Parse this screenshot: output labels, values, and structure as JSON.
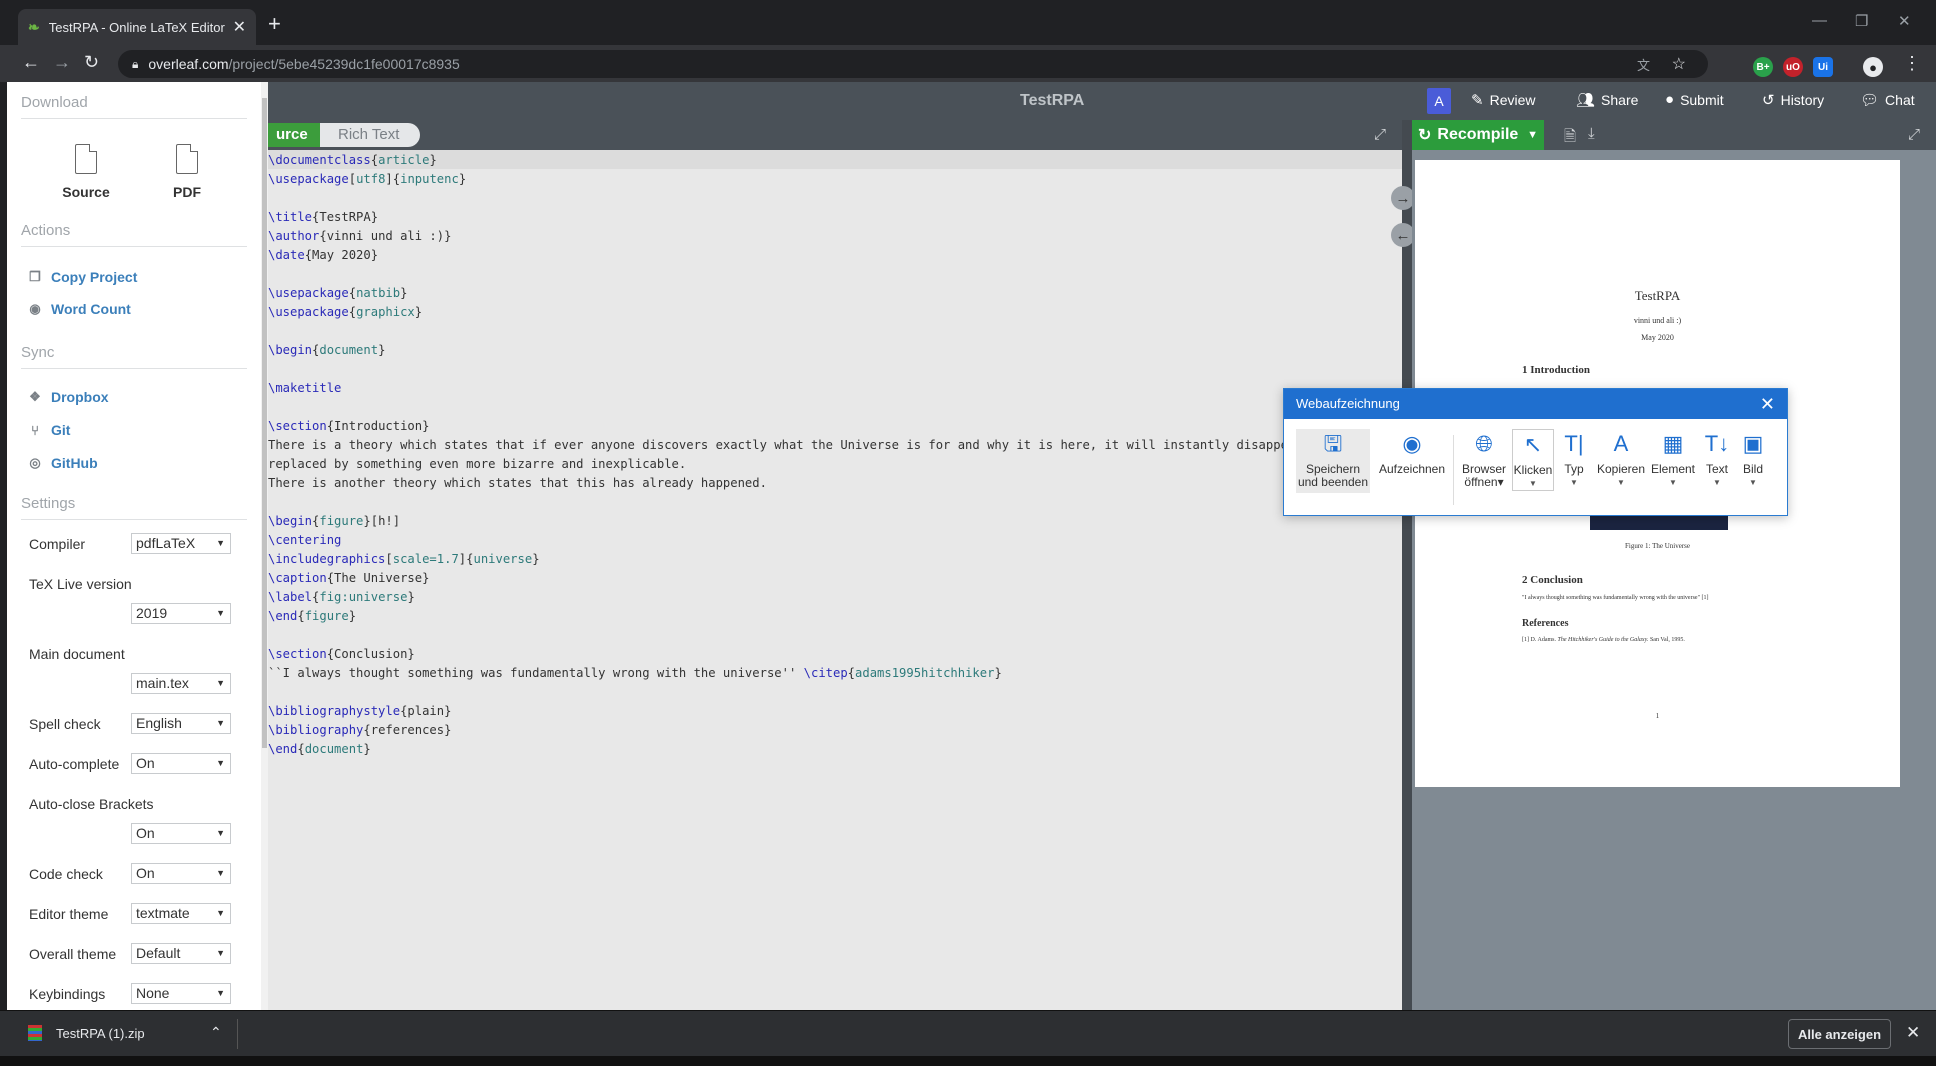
{
  "browser": {
    "tab_title": "TestRPA - Online LaTeX Editor Ov",
    "tab_favicon": "overleaf-leaf-icon",
    "new_tab": "+",
    "url_domain": "overleaf.com",
    "url_path": "/project/5ebe45239dc1fe00017c8935",
    "extensions": [
      "B+",
      "uO",
      "Ui"
    ]
  },
  "toolbar": {
    "project_title": "TestRPA",
    "avatar_letter": "A",
    "review": "Review",
    "share": "Share",
    "submit": "Submit",
    "history": "History",
    "chat": "Chat"
  },
  "sidebar": {
    "download_header": "Download",
    "download_source": "Source",
    "download_pdf": "PDF",
    "actions_header": "Actions",
    "copy_project": "Copy Project",
    "word_count": "Word Count",
    "sync_header": "Sync",
    "dropbox": "Dropbox",
    "git": "Git",
    "github": "GitHub",
    "settings_header": "Settings",
    "settings": {
      "compiler": {
        "label": "Compiler",
        "value": "pdfLaTeX"
      },
      "texlive": {
        "label": "TeX Live version",
        "value": "2019"
      },
      "main_document": {
        "label": "Main document",
        "value": "main.tex"
      },
      "spell_check": {
        "label": "Spell check",
        "value": "English"
      },
      "auto_complete": {
        "label": "Auto-complete",
        "value": "On"
      },
      "auto_close": {
        "label": "Auto-close Brackets",
        "value": "On"
      },
      "code_check": {
        "label": "Code check",
        "value": "On"
      },
      "editor_theme": {
        "label": "Editor theme",
        "value": "textmate"
      },
      "overall_theme": {
        "label": "Overall theme",
        "value": "Default"
      },
      "keybindings": {
        "label": "Keybindings",
        "value": "None"
      }
    }
  },
  "editor": {
    "source_tab": "urce",
    "rich_text_tab": "Rich Text"
  },
  "pdf": {
    "recompile": "Recompile",
    "title": "TestRPA",
    "author": "vinni und ali :)",
    "date": "May 2020",
    "sec1": "1   Introduction",
    "fig_caption": "Figure 1: The Universe",
    "sec2": "2   Conclusion",
    "conclusion_text": "\"I always thought something was fundamentally wrong with the universe\" [1]",
    "references": "References",
    "ref1_a": "[1] D. Adams.",
    "ref1_b": "The Hitchhiker's Guide to the Galaxy.",
    "ref1_c": "San Val, 1995.",
    "page_number": "1"
  },
  "popup": {
    "title": "Webaufzeichnung",
    "save_line1": "Speichern",
    "save_line2": "und beenden",
    "record": "Aufzeichnen",
    "browser_line1": "Browser",
    "browser_line2": "öffnen",
    "click": "Klicken",
    "type": "Typ",
    "copy": "Kopieren",
    "element": "Element",
    "text": "Text",
    "image": "Bild"
  },
  "downloads": {
    "file": "TestRPA (1).zip",
    "show_all": "Alle anzeigen"
  }
}
